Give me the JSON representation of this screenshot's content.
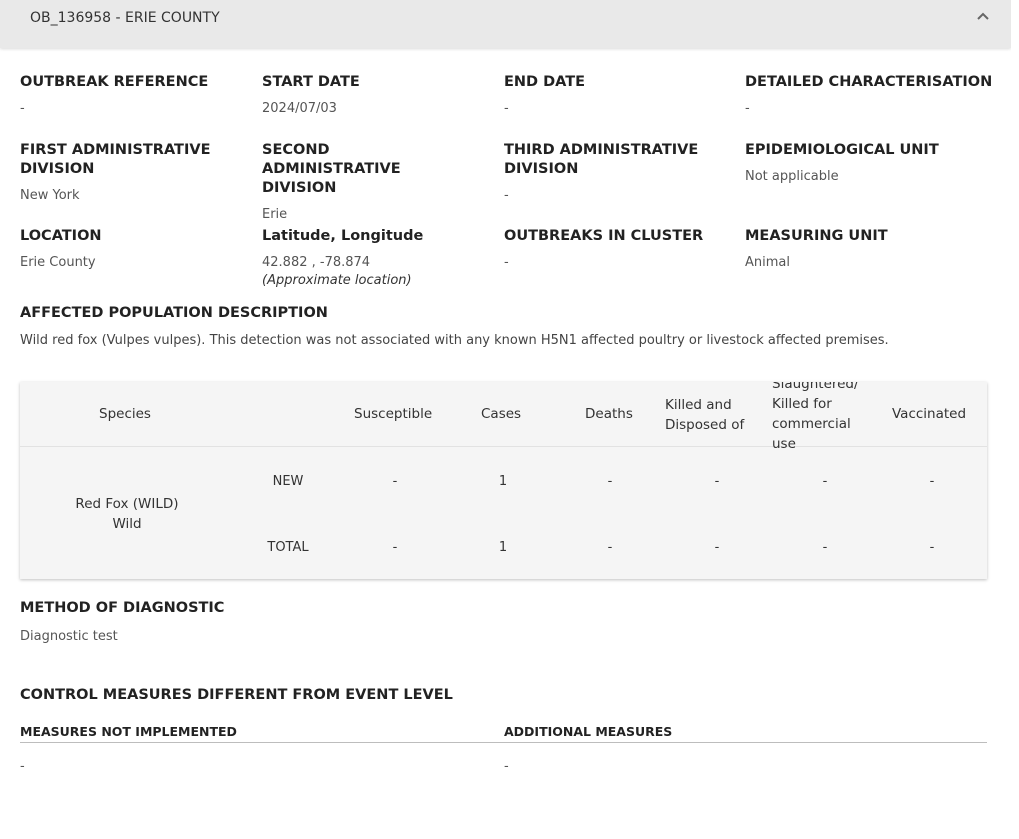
{
  "header": {
    "title": "OB_136958 - ERIE COUNTY",
    "toggle_icon": "chevron-up-icon"
  },
  "fields": {
    "outbreak_reference": {
      "label": "OUTBREAK REFERENCE",
      "value": "-"
    },
    "start_date": {
      "label": "START DATE",
      "value": "2024/07/03"
    },
    "end_date": {
      "label": "END DATE",
      "value": "-"
    },
    "detailed_characterisation": {
      "label": "DETAILED CHARACTERISATION",
      "value": "-"
    },
    "first_admin_division": {
      "label": "FIRST ADMINISTRATIVE DIVISION",
      "value": "New York"
    },
    "second_admin_division": {
      "label": "SECOND ADMINISTRATIVE DIVISION",
      "value": "Erie"
    },
    "third_admin_division": {
      "label": "THIRD ADMINISTRATIVE DIVISION",
      "value": "-"
    },
    "epidemiological_unit": {
      "label": "EPIDEMIOLOGICAL UNIT",
      "value": "Not applicable"
    },
    "location": {
      "label": "LOCATION",
      "value": "Erie County"
    },
    "lat_long": {
      "label": "Latitude, Longitude",
      "value": "42.882 , -78.874",
      "note": "(Approximate location)"
    },
    "outbreaks_in_cluster": {
      "label": "OUTBREAKS IN CLUSTER",
      "value": "-"
    },
    "measuring_unit": {
      "label": "MEASURING UNIT",
      "value": "Animal"
    }
  },
  "affected_population": {
    "label": "AFFECTED POPULATION DESCRIPTION",
    "text": "Wild red fox (Vulpes vulpes). This detection was not associated with any known H5N1 affected poultry or livestock affected premises."
  },
  "table": {
    "headers": {
      "species": "Species",
      "susceptible": "Susceptible",
      "cases": "Cases",
      "deaths": "Deaths",
      "killed_disposed": "Killed and Disposed of",
      "slaughtered": "Slaughtered/ Killed for commercial use",
      "vaccinated": "Vaccinated"
    },
    "species_name": "Red Fox (WILD)",
    "species_type": "Wild",
    "rows": [
      {
        "type": "NEW",
        "susceptible": "-",
        "cases": "1",
        "deaths": "-",
        "killed_disposed": "-",
        "slaughtered": "-",
        "vaccinated": "-"
      },
      {
        "type": "TOTAL",
        "susceptible": "-",
        "cases": "1",
        "deaths": "-",
        "killed_disposed": "-",
        "slaughtered": "-",
        "vaccinated": "-"
      }
    ]
  },
  "method_of_diagnostic": {
    "label": "METHOD OF DIAGNOSTIC",
    "value": "Diagnostic test"
  },
  "control_measures": {
    "label": "CONTROL MEASURES DIFFERENT FROM EVENT LEVEL",
    "not_implemented": {
      "label": "MEASURES NOT IMPLEMENTED",
      "value": "-"
    },
    "additional": {
      "label": "ADDITIONAL MEASURES",
      "value": "-"
    }
  }
}
